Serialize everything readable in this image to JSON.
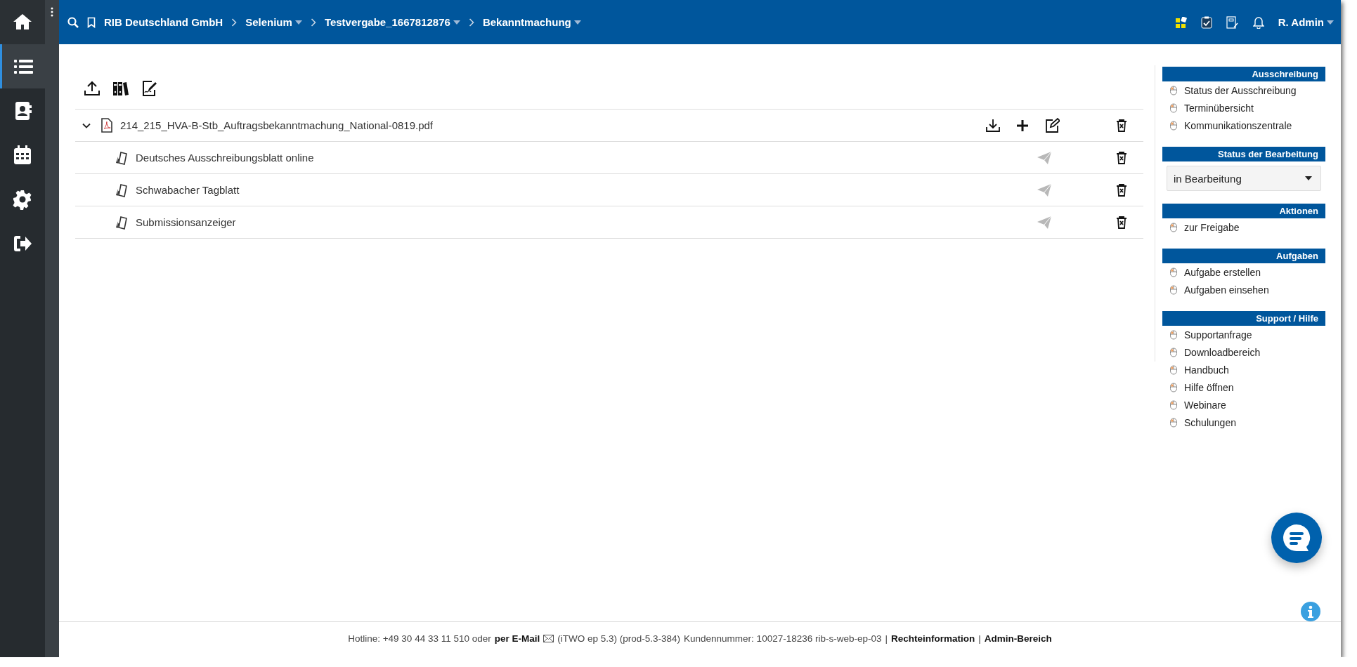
{
  "nav_rail": [
    {
      "kind": "home",
      "selected": false
    },
    {
      "kind": "list",
      "selected": true
    },
    {
      "kind": "contacts",
      "selected": false
    },
    {
      "kind": "calendar",
      "selected": false
    },
    {
      "kind": "settings",
      "selected": false
    },
    {
      "kind": "logout",
      "selected": false
    }
  ],
  "top_bar": {
    "breadcrumbs": [
      {
        "label": "RIB Deutschland GmbH",
        "dropdown": false
      },
      {
        "label": "Selenium",
        "dropdown": true
      },
      {
        "label": "Testvergabe_1667812876",
        "dropdown": true
      },
      {
        "label": "Bekanntmachung",
        "dropdown": true
      }
    ],
    "user": "R. Admin"
  },
  "documents": [
    {
      "name": "214_215_HVA-B-Stb_Auftragsbekanntmachung_National-0819.pdf",
      "expanded": true,
      "children": [
        {
          "name": "Deutsches Ausschreibungsblatt online",
          "send_disabled": true
        },
        {
          "name": "Schwabacher Tagblatt",
          "send_disabled": true
        },
        {
          "name": "Submissionsanzeiger",
          "send_disabled": true
        }
      ]
    }
  ],
  "sidebar": [
    {
      "kind": "links",
      "title": "Ausschreibung",
      "items": [
        "Status der Ausschreibung",
        "Terminübersicht",
        "Kommunikationszentrale"
      ]
    },
    {
      "kind": "select",
      "title": "Status der Bearbeitung",
      "value": "in Bearbeitung"
    },
    {
      "kind": "links",
      "title": "Aktionen",
      "items": [
        "zur Freigabe"
      ]
    },
    {
      "kind": "links",
      "title": "Aufgaben",
      "items": [
        "Aufgabe erstellen",
        "Aufgaben einsehen"
      ]
    },
    {
      "kind": "links",
      "title": "Support / Hilfe",
      "items": [
        "Supportanfrage",
        "Downloadbereich",
        "Handbuch",
        "Hilfe öffnen",
        "Webinare",
        "Schulungen"
      ]
    }
  ],
  "footer": [
    {
      "kind": "text",
      "text": "Hotline: +49 30 44 33 11 510 oder"
    },
    {
      "kind": "link",
      "text": "per E-Mail"
    },
    {
      "kind": "mail"
    },
    {
      "kind": "text",
      "text": "(iTWO ep 5.3) (prod-5.3-384)"
    },
    {
      "kind": "text",
      "text": "Kundennummer: 10027-18236 rib-s-web-ep-03"
    },
    {
      "kind": "sep",
      "text": "|"
    },
    {
      "kind": "link",
      "text": "Rechteinformation"
    },
    {
      "kind": "sep",
      "text": "|"
    },
    {
      "kind": "link",
      "text": "Admin-Bereich"
    }
  ]
}
